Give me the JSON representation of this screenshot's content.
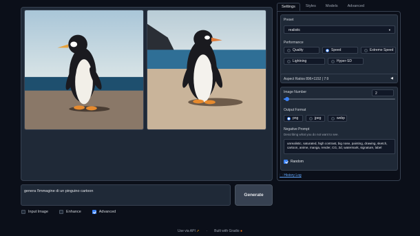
{
  "prompt": {
    "value": "genera l'immagine di un pinguino cartoon"
  },
  "generate_label": "Generate",
  "options": [
    {
      "label": "Input Image",
      "checked": false
    },
    {
      "label": "Enhance",
      "checked": false
    },
    {
      "label": "Advanced",
      "checked": true
    }
  ],
  "tabs": [
    "Settings",
    "Styles",
    "Models",
    "Advanced"
  ],
  "settings": {
    "preset_label": "Preset",
    "preset_value": "realistic",
    "performance_label": "Performance",
    "performance_options": [
      "Quality",
      "Speed",
      "Extreme Speed",
      "Lightning",
      "Hyper-SD"
    ],
    "performance_selected": "Speed",
    "aspect_ratios": "Aspect Ratios 896×1152 | 7:9",
    "image_number_label": "Image Number",
    "image_number": "2",
    "image_number_fraction": 0.03,
    "output_format_label": "Output Format",
    "output_formats": [
      "png",
      "jpeg",
      "webp"
    ],
    "output_format_selected": "png",
    "negative_prompt_label": "Negative Prompt",
    "negative_prompt_hint": "Describing what you do not want to see.",
    "negative_prompt": "unrealistic, saturated, high contrast, big nose, painting, drawing, sketch, cartoon, anime, manga, render, CG, 3d, watermark, signature, label",
    "random_label": "Random",
    "random_checked": true
  },
  "history_log": "History Log",
  "footer": {
    "api": "Use via API",
    "built": "Built with Gradio"
  }
}
